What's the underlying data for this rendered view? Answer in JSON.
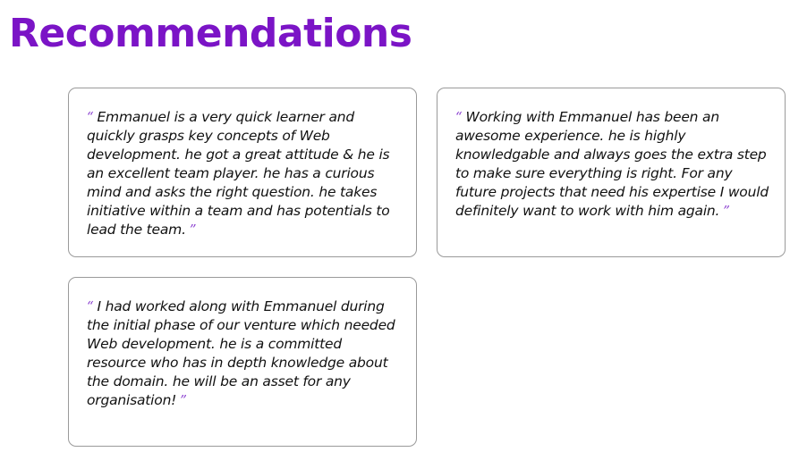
{
  "page": {
    "title": "Recommendations"
  },
  "recommendations": [
    {
      "open_quote": "“",
      "text": "Emmanuel is a very quick learner and quickly grasps key concepts of Web development. he got a great attitude & he is an excellent team player. he has a curious mind and asks the right question. he takes initiative within a team and has potentials to lead the team.",
      "close_quote": "”"
    },
    {
      "open_quote": "“",
      "text": "Working with Emmanuel has been an awesome experience. he is highly knowledgable and always goes the extra step to make sure everything is right. For any future projects that need his expertise I would definitely want to work with him again.",
      "close_quote": "”"
    },
    {
      "open_quote": "“",
      "text": "I had worked along with Emmanuel during the initial phase of our venture which needed Web development. he is a committed resource who has in depth knowledge about the domain. he will be an asset for any organisation!",
      "close_quote": "”"
    }
  ],
  "colors": {
    "title": "#7b14c6",
    "quote_mark": "#8a3fd0",
    "card_border": "#9a9a9a",
    "text": "#111111"
  }
}
